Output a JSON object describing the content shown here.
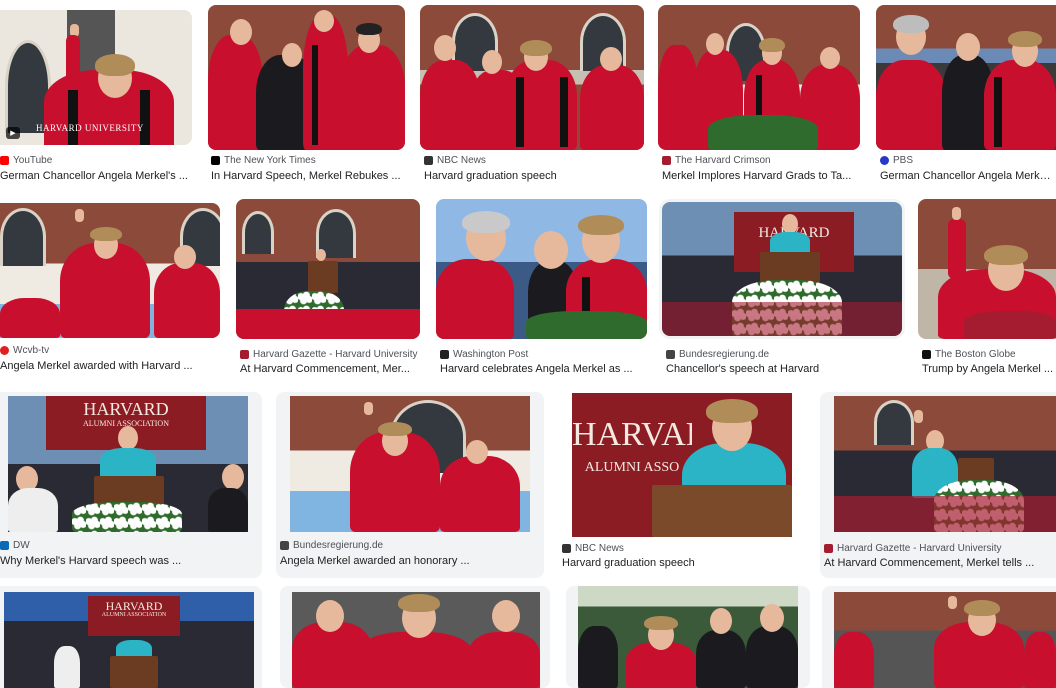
{
  "colors": {
    "crimson": "#a51c30",
    "gown_red": "#c8102e",
    "black": "#111111",
    "teal": "#2ab4c6",
    "brick": "#7b3a2c",
    "sky": "#7fb5e0"
  },
  "results": [
    {
      "source": "YouTube",
      "favicon_color": "#ff0000",
      "title": "German Chancellor Angela Merkel's ...",
      "watermark": "HARVARD UNIVERSITY",
      "icon": "play-icon"
    },
    {
      "source": "The New York Times",
      "favicon_color": "#000000",
      "title": "In Harvard Speech, Merkel Rebukes ..."
    },
    {
      "source": "NBC News",
      "favicon_color": "#333333",
      "title": "Harvard graduation speech"
    },
    {
      "source": "The Harvard Crimson",
      "favicon_color": "#a51c30",
      "title": "Merkel Implores Harvard Grads to Ta..."
    },
    {
      "source": "PBS",
      "favicon_color": "#2638c4",
      "title": "German Chancellor Angela Merkel ..."
    },
    {
      "source": "Wcvb-tv",
      "favicon_color": "#e02020",
      "title": "Angela Merkel awarded with Harvard ..."
    },
    {
      "source": "Harvard Gazette - Harvard University",
      "favicon_color": "#a51c30",
      "title": "At Harvard Commencement, Mer..."
    },
    {
      "source": "Washington Post",
      "favicon_color": "#222222",
      "title": "Harvard celebrates Angela Merkel as ..."
    },
    {
      "source": "Bundesregierung.de",
      "favicon_color": "#444444",
      "title": "Chancellor's speech at Harvard",
      "banner": "HARVARD"
    },
    {
      "source": "The Boston Globe",
      "favicon_color": "#111111",
      "title": "Trump by Angela Merkel ..."
    },
    {
      "source": "DW",
      "favicon_color": "#0a6ab6",
      "title": "Why Merkel's Harvard speech was ...",
      "banner": "HARVARD",
      "banner_sub": "ALUMNI ASSOCIATION"
    },
    {
      "source": "Bundesregierung.de",
      "favicon_color": "#444444",
      "title": "Angela Merkel awarded an honorary ..."
    },
    {
      "source": "NBC News",
      "favicon_color": "#333333",
      "title": "Harvard graduation speech",
      "banner": "HARVAR",
      "banner_sub": "ALUMNI ASSO"
    },
    {
      "source": "Harvard Gazette - Harvard University",
      "favicon_color": "#a51c30",
      "title": "At Harvard Commencement, Merkel tells ..."
    },
    {
      "banner": "HARVARD",
      "banner_sub": "ALUMNI ASSOCIATION"
    },
    {},
    {},
    {}
  ]
}
